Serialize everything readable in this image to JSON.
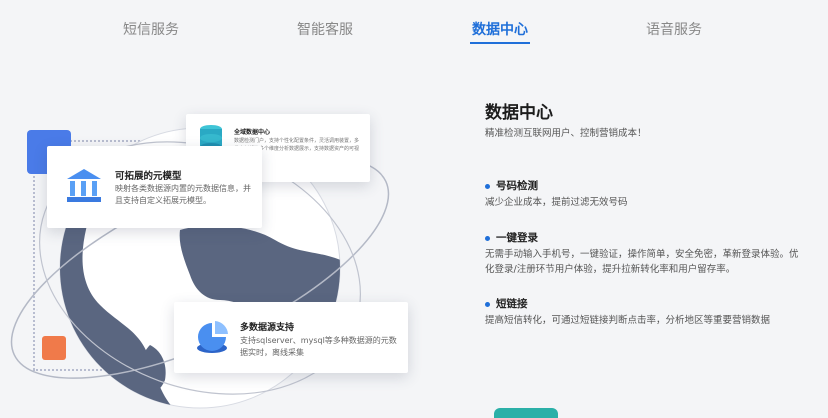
{
  "tabs": [
    {
      "label": "短信服务"
    },
    {
      "label": "智能客服"
    },
    {
      "label": "数据中心"
    },
    {
      "label": "语音服务"
    }
  ],
  "active_tab": "数据中心",
  "illustration": {
    "card_a": {
      "title": "全域数据中心",
      "desc": "数据检测门户，支持个性化配置条件，灵活调用装置，多维度剖析等多个维度分析数据展示，支持数据资产的可视化！"
    },
    "card_b": {
      "title": "可拓展的元模型",
      "desc": "映射各类数据源内置的元数据信息，并且支持自定义拓展元模型。"
    },
    "card_c": {
      "title": "多数据源支持",
      "desc": "支持sqlserver、mysql等多种数据源的元数据实时，离线采集"
    }
  },
  "content": {
    "title": "数据中心",
    "subtitle": "精准检测互联网用户、控制营销成本！",
    "features": [
      {
        "title": "号码检测",
        "desc": "减少企业成本，提前过滤无效号码"
      },
      {
        "title": "一键登录",
        "desc": "无需手动输入手机号，一键验证，操作简单，安全免密，革新登录体验。优化登录/注册环节用户体验，提升拉新转化率和用户留存率。"
      },
      {
        "title": "短链接",
        "desc": "提高短信转化，可通过短链接判断点击率，分析地区等重要营销数据"
      }
    ]
  },
  "colors": {
    "accent": "#1f6fd9",
    "globe": "#5a6680",
    "blue_square": "#4a7be8",
    "orange_square": "#f07a4a"
  }
}
